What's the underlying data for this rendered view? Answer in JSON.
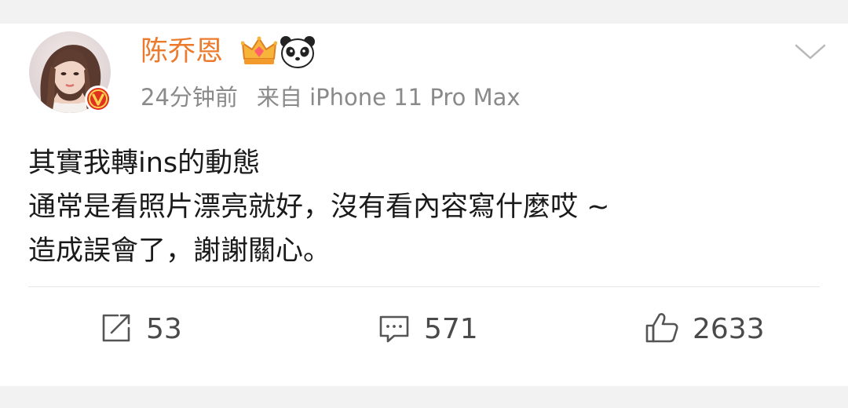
{
  "post": {
    "author": {
      "name": "陈乔恩",
      "avatar": "avatar-photo",
      "badges": [
        "crown-icon",
        "panda-icon"
      ],
      "verified": true
    },
    "meta": {
      "time": "24分钟前",
      "source": "来自 iPhone 11 Pro Max"
    },
    "lines": [
      "其實我轉ins的動態",
      "通常是看照片漂亮就好，沒有看內容寫什麼哎 ~",
      "造成誤會了，謝謝關心。"
    ],
    "actions": {
      "repost_count": "53",
      "comment_count": "571",
      "like_count": "2633"
    }
  },
  "colors": {
    "username": "#eb7a2d",
    "meta_text": "#8a8a8a",
    "body_text": "#1a1a1a",
    "action_text": "#4a4a4a",
    "page_bg": "#f2f2f2",
    "card_bg": "#ffffff",
    "verified_badge": "#e03020"
  }
}
